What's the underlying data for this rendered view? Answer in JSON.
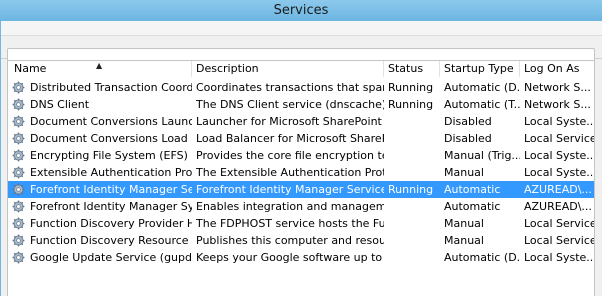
{
  "window": {
    "title": "Services"
  },
  "table": {
    "columns": [
      {
        "key": "name",
        "label": "Name"
      },
      {
        "key": "description",
        "label": "Description"
      },
      {
        "key": "status",
        "label": "Status"
      },
      {
        "key": "startup",
        "label": "Startup Type"
      },
      {
        "key": "logon",
        "label": "Log On As"
      }
    ],
    "sort_indicator": "▲",
    "rows": [
      {
        "name": "Distributed Transaction Coordin...",
        "description": "Coordinates transactions that span ...",
        "status": "Running",
        "startup": "Automatic (D...",
        "logon": "Network S...",
        "selected": false
      },
      {
        "name": "DNS Client",
        "description": "The DNS Client service (dnscache) ca...",
        "status": "Running",
        "startup": "Automatic (T...",
        "logon": "Network S...",
        "selected": false
      },
      {
        "name": "Document Conversions Launch...",
        "description": "Launcher for Microsoft SharePoint S...",
        "status": "",
        "startup": "Disabled",
        "logon": "Local Syste...",
        "selected": false
      },
      {
        "name": "Document Conversions Load Ba...",
        "description": "Load Balancer for Microsoft SharePoi...",
        "status": "",
        "startup": "Disabled",
        "logon": "Local Service",
        "selected": false
      },
      {
        "name": "Encrypting File System (EFS)",
        "description": "Provides the core file encryption tec...",
        "status": "",
        "startup": "Manual (Trig...",
        "logon": "Local Syste...",
        "selected": false
      },
      {
        "name": "Extensible Authentication Proto...",
        "description": "The Extensible Authentication Protoc...",
        "status": "",
        "startup": "Manual",
        "logon": "Local Syste...",
        "selected": false
      },
      {
        "name": "Forefront Identity Manager Servi...",
        "description": "Forefront Identity Manager Service",
        "status": "Running",
        "startup": "Automatic",
        "logon": "AZUREAD\\...",
        "selected": true
      },
      {
        "name": "Forefront Identity Manager Sync...",
        "description": "Enables integration and managemen...",
        "status": "",
        "startup": "Automatic",
        "logon": "AZUREAD\\...",
        "selected": false
      },
      {
        "name": "Function Discovery Provider Host",
        "description": "The FDPHOST service hosts the Func...",
        "status": "",
        "startup": "Manual",
        "logon": "Local Service",
        "selected": false
      },
      {
        "name": "Function Discovery Resource Pu...",
        "description": "Publishes this computer and resourc...",
        "status": "",
        "startup": "Manual",
        "logon": "Local Service",
        "selected": false
      },
      {
        "name": "Google Update Service (gupdate)",
        "description": "Keeps your Google software up to da...",
        "status": "",
        "startup": "Automatic (D...",
        "logon": "Local Syste...",
        "selected": false
      }
    ]
  },
  "icons": {
    "service": "gear-icon"
  },
  "colors": {
    "selection": "#3399ff",
    "titlebar": "#6fb8e3"
  }
}
